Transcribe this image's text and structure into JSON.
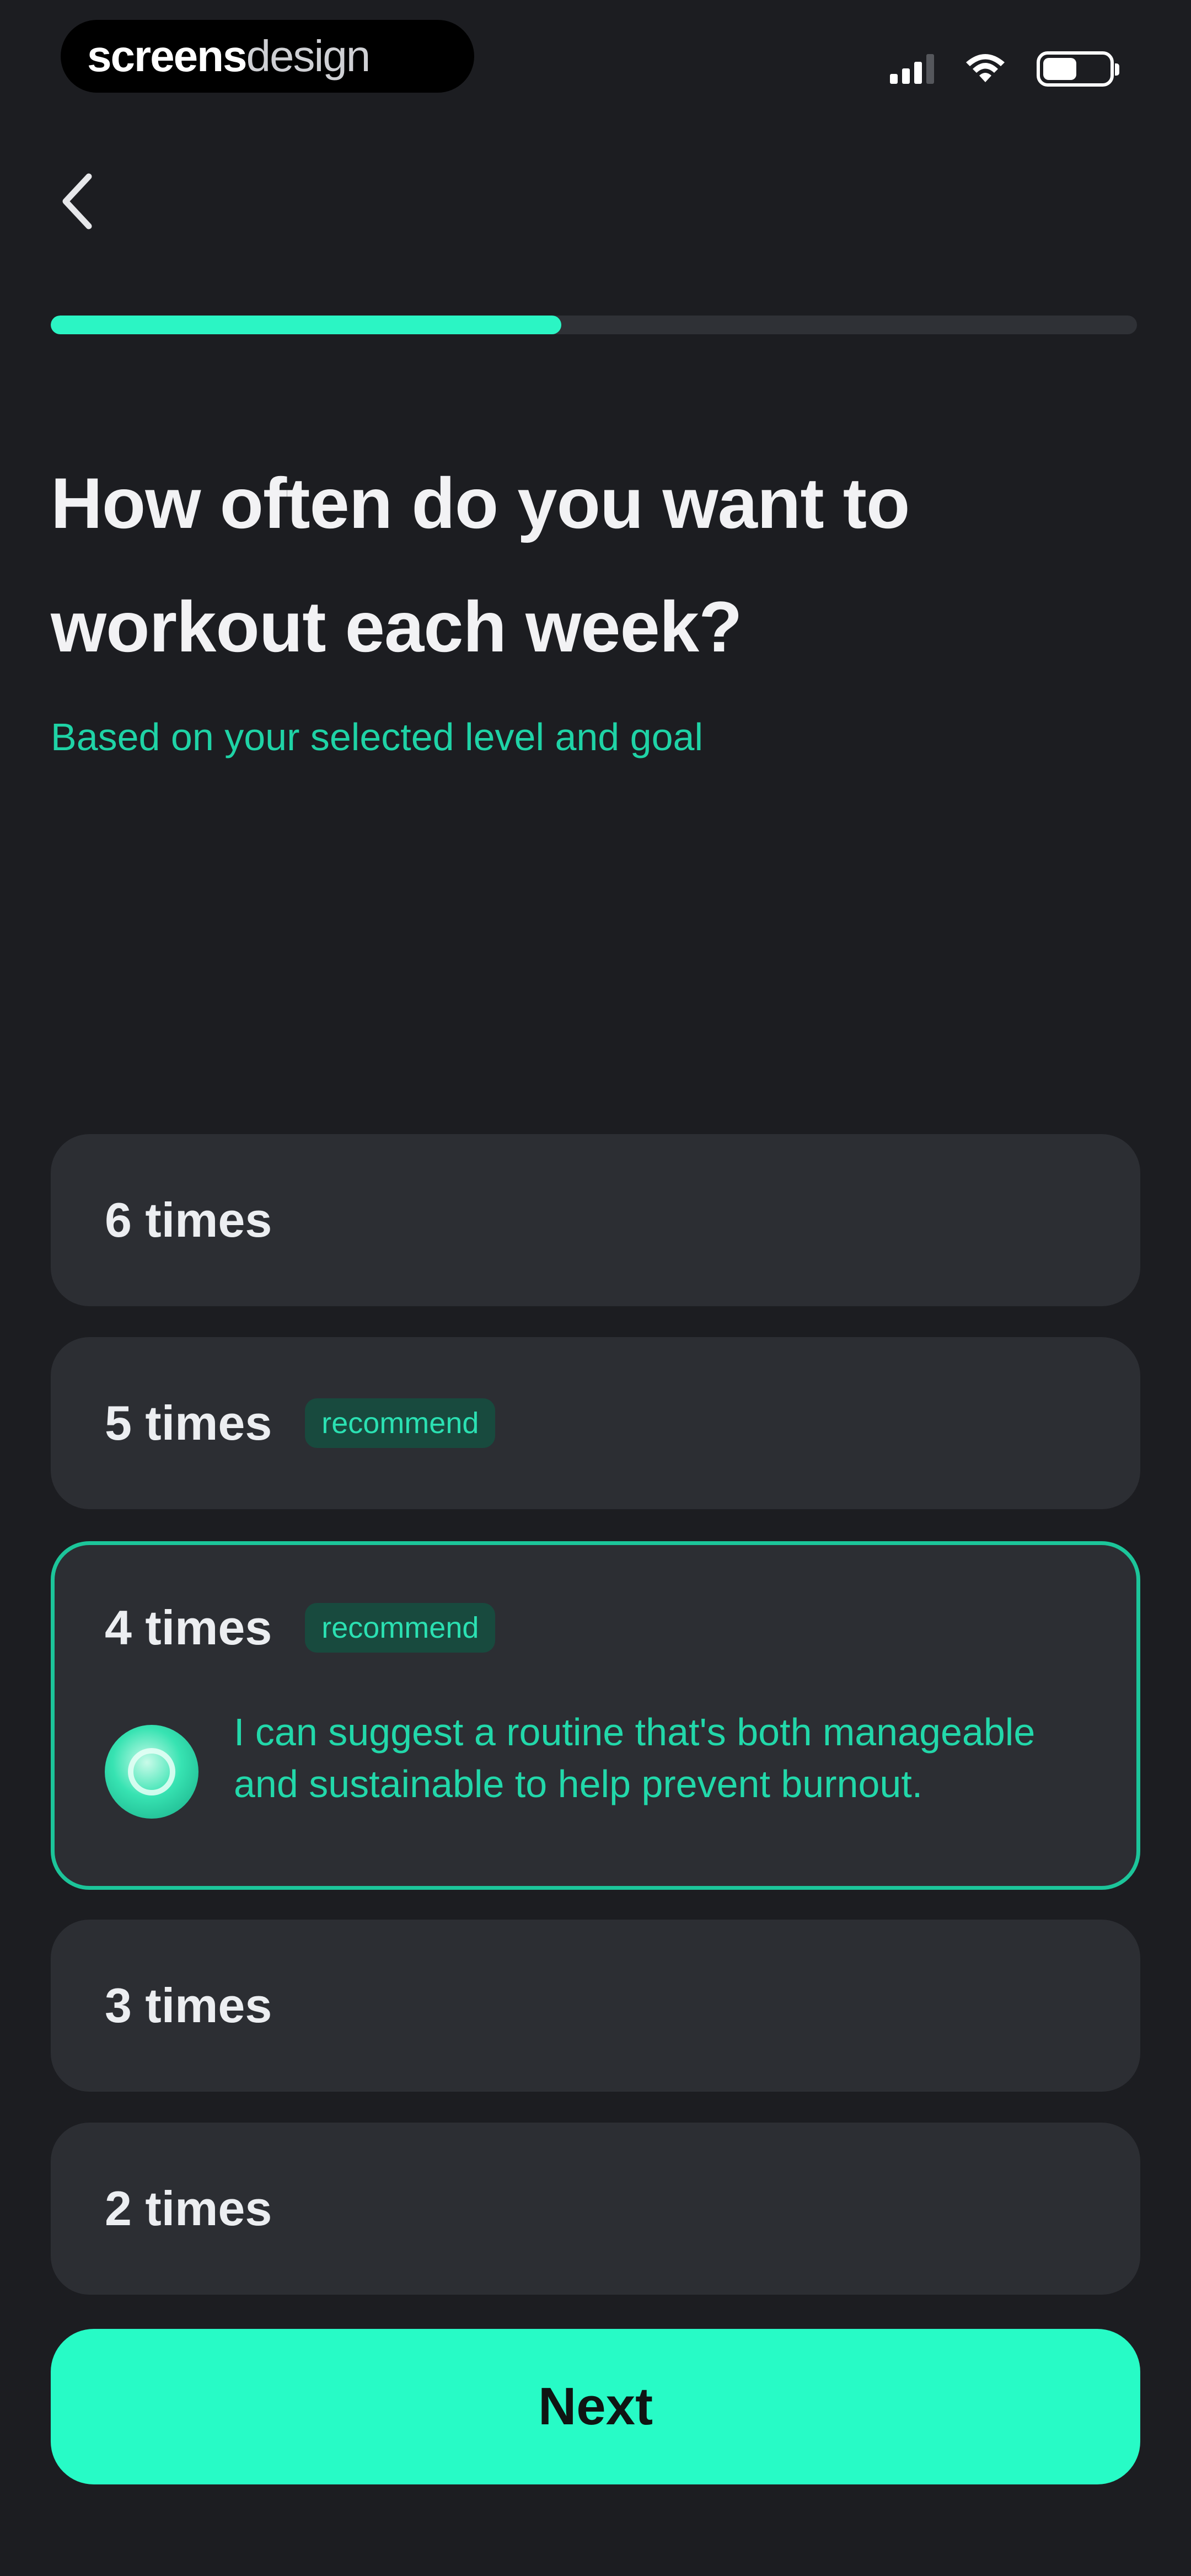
{
  "status_bar": {
    "brand_strong": "screens",
    "brand_light": "design",
    "battery_level": 0.52
  },
  "progress": {
    "value": 0.47
  },
  "question": {
    "title": "How often do you want to workout each week?",
    "subtitle": "Based on your selected level and goal"
  },
  "options": [
    {
      "label": "6 times",
      "badge": ""
    },
    {
      "label": "5 times",
      "badge": "recommend"
    },
    {
      "label": "4 times",
      "badge": "recommend",
      "selected": true,
      "coach_message": "I can suggest a routine that's both manageable and sustainable to help prevent burnout."
    },
    {
      "label": "3 times",
      "badge": ""
    },
    {
      "label": "2 times",
      "badge": ""
    }
  ],
  "actions": {
    "next_label": "Next"
  },
  "colors": {
    "accent": "#2bf5c4",
    "background": "#1c1d21",
    "card": "#2c2e33"
  },
  "icons": {
    "back": "chevron-left-icon",
    "signal": "signal-icon",
    "wifi": "wifi-icon",
    "battery": "battery-icon",
    "coach": "coach-avatar-icon"
  }
}
